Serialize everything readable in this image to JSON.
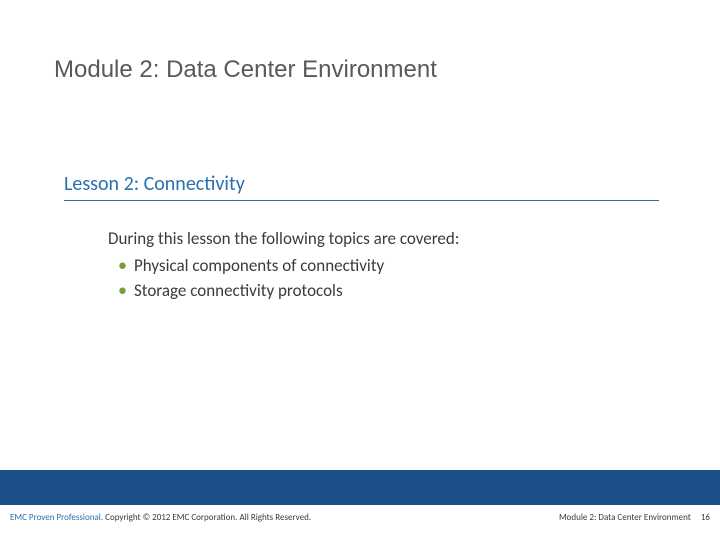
{
  "module_title": "Module 2: Data Center Environment",
  "lesson_title": "Lesson 2: Connectivity",
  "body": {
    "intro": "During this lesson the following topics are covered:",
    "bullets": [
      "Physical components of connectivity",
      "Storage connectivity protocols"
    ]
  },
  "footer": {
    "proven_professional": "EMC Proven Professional.",
    "copyright": " Copyright © 2012 EMC Corporation. All Rights Reserved.",
    "module_label": "Module 2: Data Center Environment",
    "page_number": "16"
  }
}
